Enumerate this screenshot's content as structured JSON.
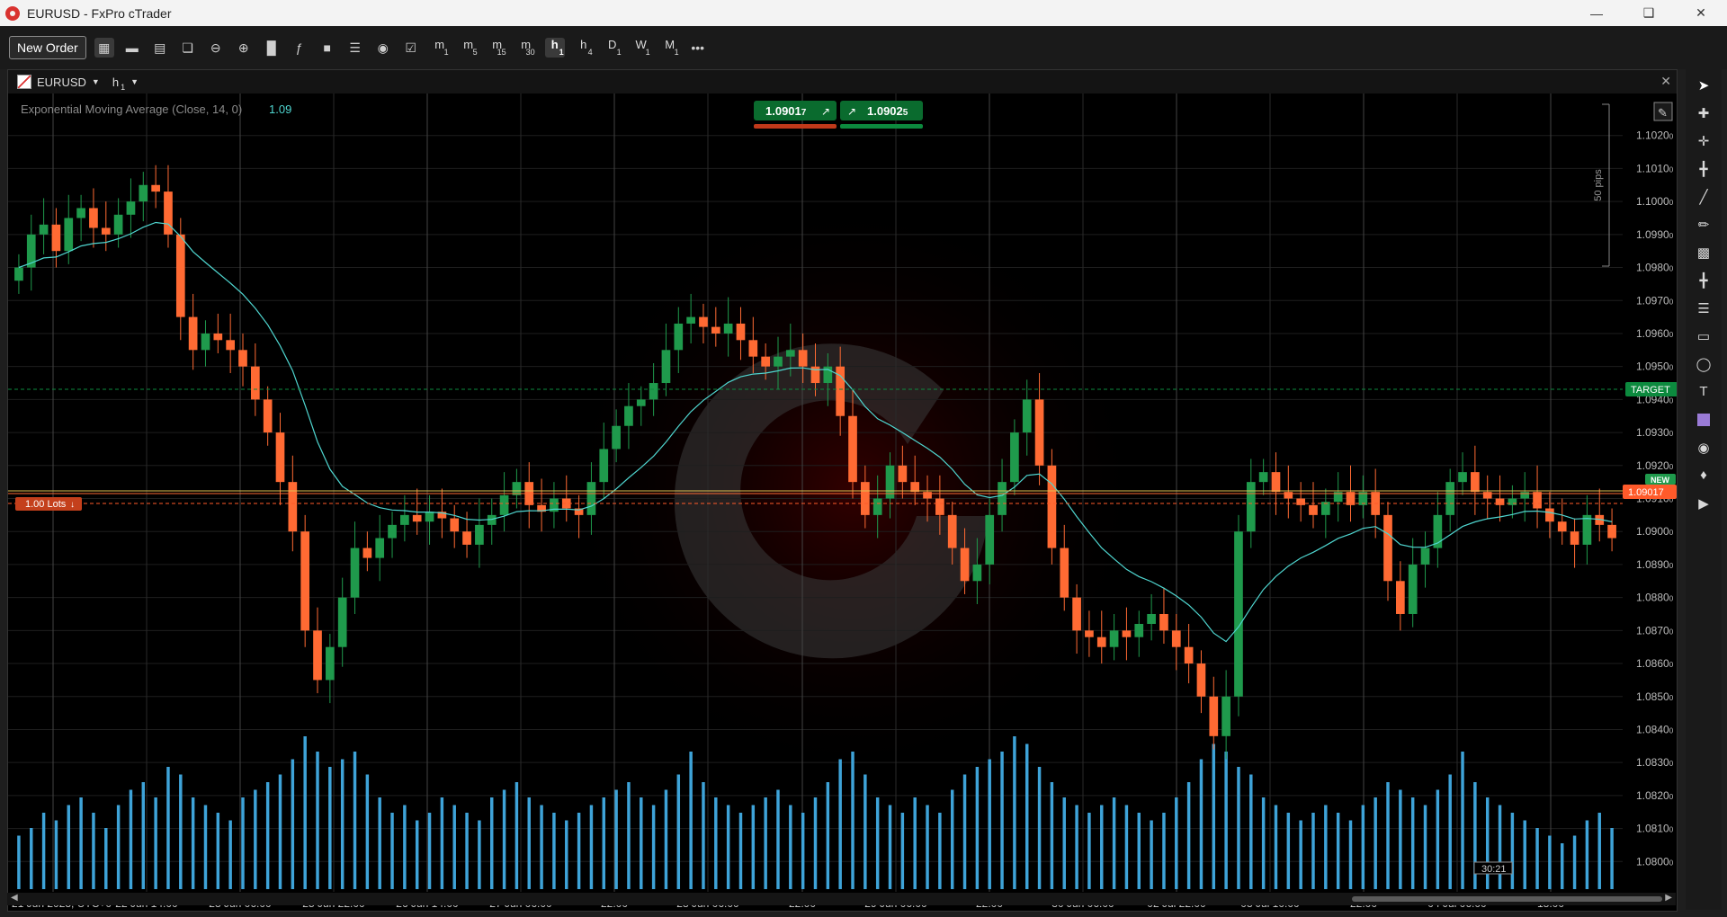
{
  "window": {
    "title": "EURUSD - FxPro cTrader"
  },
  "toolbar": {
    "new_order_label": "New Order",
    "timeframes": [
      {
        "main": "m",
        "sub": "1"
      },
      {
        "main": "m",
        "sub": "5"
      },
      {
        "main": "m",
        "sub": "15"
      },
      {
        "main": "m",
        "sub": "30"
      },
      {
        "main": "h",
        "sub": "1"
      },
      {
        "main": "h",
        "sub": "4"
      },
      {
        "main": "D",
        "sub": "1"
      },
      {
        "main": "W",
        "sub": "1"
      },
      {
        "main": "M",
        "sub": "1"
      }
    ],
    "selected_timeframe": "h1",
    "more_label": "•••"
  },
  "chart": {
    "symbol": "EURUSD",
    "timeframe_main": "h",
    "timeframe_sub": "1",
    "indicator_label": "Exponential Moving Average (Close, 14, 0)",
    "indicator_value": "1.09",
    "sell_price": {
      "main": "1.0901",
      "pipette": "7"
    },
    "buy_price": {
      "main": "1.0902",
      "pipette": "5"
    },
    "target_label": "TARGET",
    "current_price_label": "1.09017",
    "new_badge": "NEW",
    "lots_label": "1.00 Lots",
    "pips_label": "50 pips",
    "countdown": "30:21",
    "colors": {
      "bull": "#1f9a4c",
      "bear": "#ff6a33",
      "ema": "#4fd6d0",
      "volume": "#3ea3d8",
      "target": "#0c8a3e",
      "price_tag": "#ff5a2a"
    }
  },
  "chart_data": {
    "type": "candlestick",
    "y_ticks": [
      "1.1020",
      "1.1010",
      "1.1000",
      "1.0990",
      "1.0980",
      "1.0970",
      "1.0960",
      "1.0950",
      "1.0940",
      "1.0930",
      "1.0920",
      "1.0910",
      "1.0900",
      "1.0890",
      "1.0880",
      "1.0870",
      "1.0860",
      "1.0850",
      "1.0840",
      "1.0830",
      "1.0820",
      "1.0810",
      "1.0800"
    ],
    "y_tick_pipettes": [
      "0",
      "0",
      "0",
      "0",
      "0",
      "0",
      "0",
      "0",
      "0",
      "0",
      "0",
      "0",
      "0",
      "0",
      "0",
      "0",
      "0",
      "0",
      "0",
      "0",
      "0",
      "0",
      "0"
    ],
    "ylim": [
      1.0793,
      1.103
    ],
    "x_labels": [
      "21 Jun 2023, UTC+0",
      "22 Jun 14:00",
      "23 Jun 06:00",
      "25 Jun 22:00",
      "26 Jun 14:00",
      "27 Jun 06:00",
      "22:00",
      "28 Jun 06:00",
      "22:00",
      "29 Jun 06:00",
      "22:00",
      "30 Jun 06:00",
      "02 Jul 22:00",
      "03 Jul 10:00",
      "22:00",
      "04 Jul 06:00",
      "18:00"
    ],
    "ohlc_close": [
      1.098,
      1.099,
      1.0993,
      1.0985,
      1.0995,
      1.0998,
      1.0992,
      1.099,
      1.0996,
      1.1,
      1.1005,
      1.1003,
      1.099,
      1.0965,
      1.0955,
      1.096,
      1.0958,
      1.0955,
      1.095,
      1.094,
      1.093,
      1.0915,
      1.09,
      1.087,
      1.0855,
      1.0865,
      1.088,
      1.0895,
      1.0892,
      1.0898,
      1.0902,
      1.0905,
      1.0903,
      1.0906,
      1.0904,
      1.09,
      1.0896,
      1.0902,
      1.0905,
      1.0911,
      1.0915,
      1.0908,
      1.0906,
      1.091,
      1.0907,
      1.0905,
      1.0915,
      1.0925,
      1.0932,
      1.0938,
      1.094,
      1.0945,
      1.0955,
      1.0963,
      1.0965,
      1.0962,
      1.096,
      1.0963,
      1.0958,
      1.0953,
      1.095,
      1.0953,
      1.0955,
      1.095,
      1.0945,
      1.095,
      1.0935,
      1.0915,
      1.0905,
      1.091,
      1.092,
      1.0915,
      1.0912,
      1.091,
      1.0905,
      1.0895,
      1.0885,
      1.089,
      1.0905,
      1.0915,
      1.093,
      1.094,
      1.092,
      1.0895,
      1.088,
      1.087,
      1.0868,
      1.0865,
      1.087,
      1.0868,
      1.0872,
      1.0875,
      1.087,
      1.0865,
      1.086,
      1.085,
      1.0838,
      1.085,
      1.09,
      1.0915,
      1.0918,
      1.0912,
      1.091,
      1.0908,
      1.0905,
      1.0909,
      1.0912,
      1.0908,
      1.0912,
      1.0905,
      1.0885,
      1.0875,
      1.089,
      1.0895,
      1.0905,
      1.0915,
      1.0918,
      1.0912,
      1.091,
      1.0908,
      1.091,
      1.0912,
      1.0907,
      1.0903,
      1.09,
      1.0896,
      1.0905,
      1.0902,
      1.0898
    ],
    "ema_period": 14,
    "volume_relative": [
      0.35,
      0.4,
      0.5,
      0.45,
      0.55,
      0.6,
      0.5,
      0.4,
      0.55,
      0.65,
      0.7,
      0.6,
      0.8,
      0.75,
      0.6,
      0.55,
      0.5,
      0.45,
      0.6,
      0.65,
      0.7,
      0.75,
      0.85,
      1.0,
      0.9,
      0.8,
      0.85,
      0.9,
      0.75,
      0.6,
      0.5,
      0.55,
      0.45,
      0.5,
      0.6,
      0.55,
      0.5,
      0.45,
      0.6,
      0.65,
      0.7,
      0.6,
      0.55,
      0.5,
      0.45,
      0.5,
      0.55,
      0.6,
      0.65,
      0.7,
      0.6,
      0.55,
      0.65,
      0.75,
      0.9,
      0.7,
      0.6,
      0.55,
      0.5,
      0.55,
      0.6,
      0.65,
      0.55,
      0.5,
      0.6,
      0.7,
      0.85,
      0.9,
      0.75,
      0.6,
      0.55,
      0.5,
      0.6,
      0.55,
      0.5,
      0.65,
      0.75,
      0.8,
      0.85,
      0.9,
      1.0,
      0.95,
      0.8,
      0.7,
      0.6,
      0.55,
      0.5,
      0.55,
      0.6,
      0.55,
      0.5,
      0.45,
      0.5,
      0.6,
      0.7,
      0.85,
      0.95,
      0.9,
      0.8,
      0.75,
      0.6,
      0.55,
      0.5,
      0.45,
      0.5,
      0.55,
      0.5,
      0.45,
      0.55,
      0.6,
      0.7,
      0.65,
      0.6,
      0.55,
      0.65,
      0.75,
      0.9,
      0.7,
      0.6,
      0.55,
      0.5,
      0.45,
      0.4,
      0.35,
      0.3,
      0.35,
      0.45,
      0.5,
      0.4,
      0.35
    ]
  }
}
